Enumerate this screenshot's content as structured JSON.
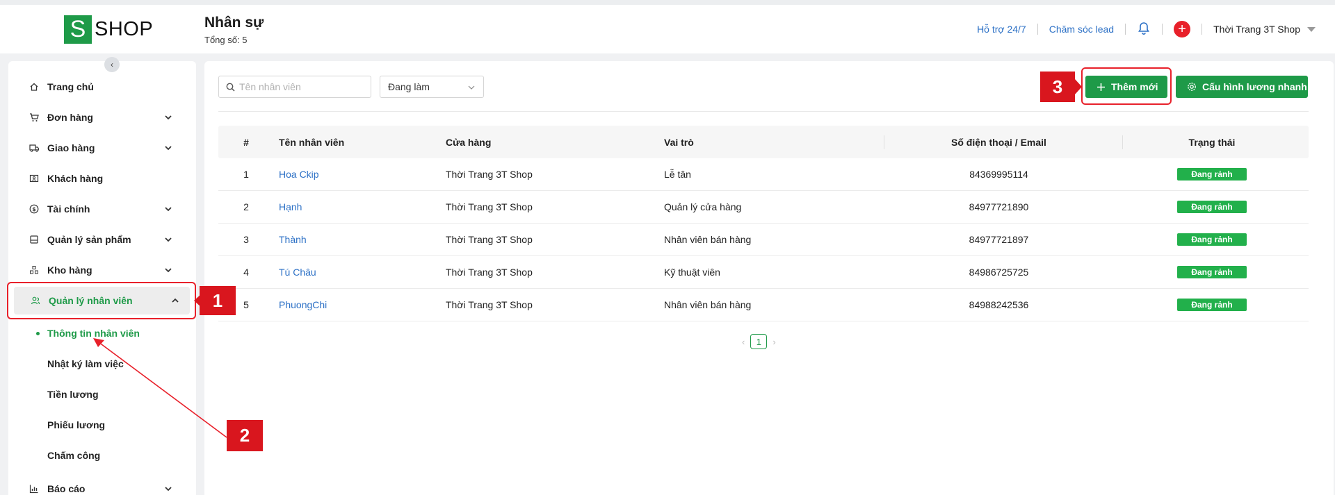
{
  "header": {
    "logo_letter": "S",
    "logo_text": "SHOP",
    "title": "Nhân sự",
    "subtitle": "Tổng số: 5",
    "support_link": "Hỗ trợ 24/7",
    "lead_link": "Chăm sóc lead",
    "shop_name": "Thời Trang 3T Shop"
  },
  "sidebar": {
    "items": [
      {
        "label": "Trang chủ",
        "icon": "home-icon"
      },
      {
        "label": "Đơn hàng",
        "icon": "cart-icon"
      },
      {
        "label": "Giao hàng",
        "icon": "truck-icon"
      },
      {
        "label": "Khách hàng",
        "icon": "contact-card-icon"
      },
      {
        "label": "Tài chính",
        "icon": "dollar-circle-icon"
      },
      {
        "label": "Quản lý sản phẩm",
        "icon": "box-icon"
      },
      {
        "label": "Kho hàng",
        "icon": "warehouse-icon"
      },
      {
        "label": "Quản lý nhân viên",
        "icon": "users-icon"
      },
      {
        "label": "Báo cáo",
        "icon": "chart-icon"
      }
    ],
    "sub_items": [
      "Thông tin nhân viên",
      "Nhật ký làm việc",
      "Tiền lương",
      "Phiếu lương",
      "Chấm công"
    ]
  },
  "toolbar": {
    "search_placeholder": "Tên nhân viên",
    "status_filter": "Đang làm",
    "add_label": "Thêm mới",
    "config_label": "Cấu hình lương nhanh"
  },
  "table": {
    "headers": [
      "#",
      "Tên nhân viên",
      "Cửa hàng",
      "Vai trò",
      "Số điện thoại / Email",
      "Trạng thái"
    ],
    "rows": [
      {
        "num": "1",
        "name": "Hoa Ckip",
        "store": "Thời Trang 3T Shop",
        "role": "Lễ tân",
        "phone": "84369995114",
        "status": "Đang rảnh"
      },
      {
        "num": "2",
        "name": "Hạnh",
        "store": "Thời Trang 3T Shop",
        "role": "Quản lý cửa hàng",
        "phone": "84977721890",
        "status": "Đang rảnh"
      },
      {
        "num": "3",
        "name": "Thành",
        "store": "Thời Trang 3T Shop",
        "role": "Nhân viên bán hàng",
        "phone": "84977721897",
        "status": "Đang rảnh"
      },
      {
        "num": "4",
        "name": "Tú Châu",
        "store": "Thời Trang 3T Shop",
        "role": "Kỹ thuật viên",
        "phone": "84986725725",
        "status": "Đang rảnh"
      },
      {
        "num": "5",
        "name": "PhuongChi",
        "store": "Thời Trang 3T Shop",
        "role": "Nhân viên bán hàng",
        "phone": "84988242536",
        "status": "Đang rảnh"
      }
    ]
  },
  "pagination": {
    "current": "1"
  },
  "annotations": {
    "step1": "1",
    "step2": "2",
    "step3": "3"
  },
  "colors": {
    "brand_green": "#1e9a48",
    "link_blue": "#2d71c6",
    "annotation_red": "#e8202a"
  }
}
